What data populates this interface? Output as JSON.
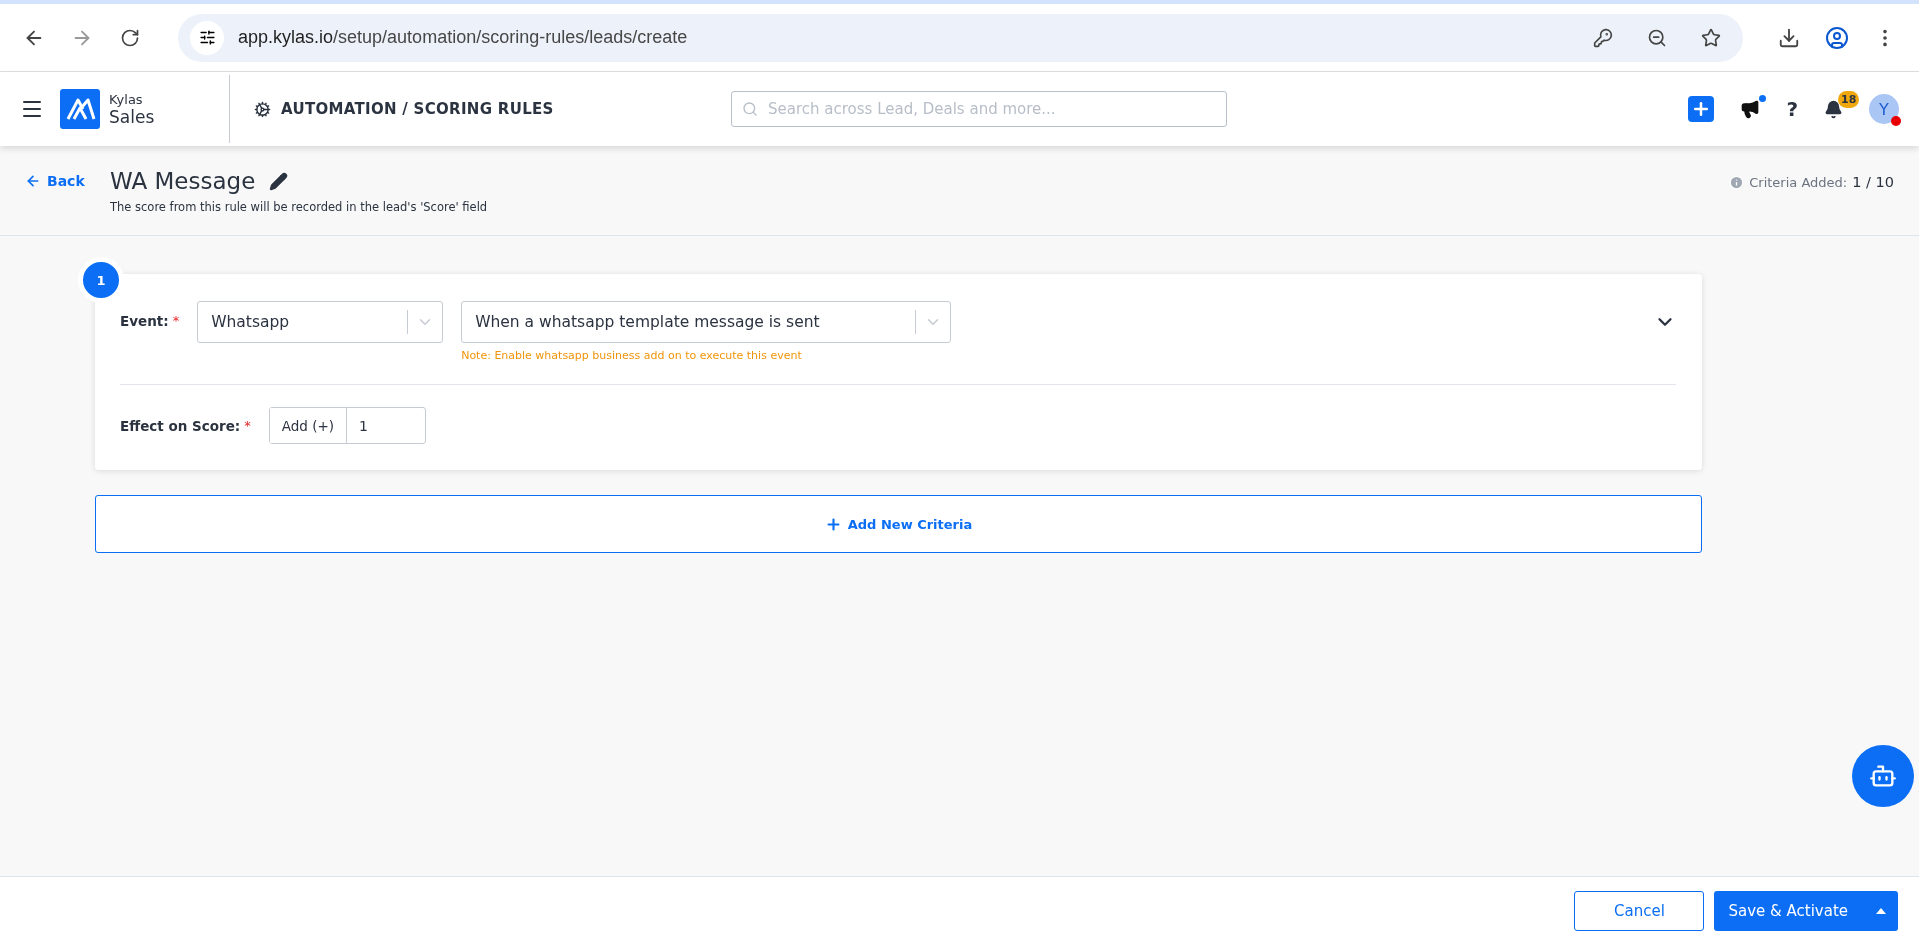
{
  "browser": {
    "url_host": "app.kylas.io",
    "url_path": "/setup/automation/scoring-rules/leads/create"
  },
  "header": {
    "brand": "Kylas",
    "product": "Sales",
    "breadcrumb": "AUTOMATION / SCORING RULES",
    "search": {
      "placeholder": "Search across Lead, Deals and more..."
    },
    "notification_count": "18",
    "announcement_unread": true,
    "help": "?",
    "avatar": "Y",
    "avatar_online": false
  },
  "page": {
    "back": "Back",
    "title": "WA Message",
    "subtitle": "The score from this rule will be recorded in the lead's 'Score' field",
    "criteria_label": "Criteria Added:",
    "criteria_value": "1 / 10"
  },
  "criteria": [
    {
      "number": "1",
      "expanded": false,
      "event_label": "Event:",
      "event_required_mark": "*",
      "effect_required_mark": "*",
      "event_type": "Whatsapp",
      "event": "When a whatsapp template message is sent",
      "note": "Note: Enable whatsapp business add on to execute this event",
      "effect_label": "Effect on Score:",
      "operation": "Add (+)",
      "value": "1"
    }
  ],
  "add_criteria": "Add New Criteria",
  "footer": {
    "cancel": "Cancel",
    "save": "Save & Activate"
  }
}
